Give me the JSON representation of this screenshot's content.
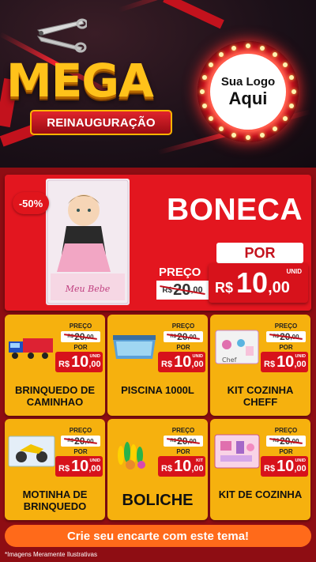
{
  "header": {
    "title_main": "MEGA",
    "title_sub": "REINAUGURAÇÃO",
    "logo_line1": "Sua Logo",
    "logo_line2": "Aqui"
  },
  "hero": {
    "discount": "-50%",
    "name": "BONECA",
    "por_label": "POR",
    "preco_label": "PREÇO",
    "old_currency": "R$",
    "old_int": "20",
    "old_dec": ",00",
    "unit_label": "UNID",
    "currency": "R$",
    "price_int": "10",
    "price_dec": ",00"
  },
  "products": [
    {
      "name": "BRINQUEDO DE CAMINHAO",
      "preco_label": "PREÇO",
      "old_currency": "R$",
      "old_int": "20",
      "old_dec": ",00",
      "por_label": "POR",
      "unit": "UNID",
      "currency": "R$",
      "price_int": "10",
      "price_dec": ",00",
      "icon": "toy-truck-icon"
    },
    {
      "name": "PISCINA 1000L",
      "preco_label": "PREÇO",
      "old_currency": "R$",
      "old_int": "20",
      "old_dec": ",00",
      "por_label": "POR",
      "unit": "UNID",
      "currency": "R$",
      "price_int": "10",
      "price_dec": ",00",
      "icon": "pool-icon"
    },
    {
      "name": "KIT COZINHA CHEFF",
      "preco_label": "PREÇO",
      "old_currency": "R$",
      "old_int": "20",
      "old_dec": ",00",
      "por_label": "POR",
      "unit": "UNID",
      "currency": "R$",
      "price_int": "10",
      "price_dec": ",00",
      "icon": "kitchen-kit-icon"
    },
    {
      "name": "MOTINHA DE BRINQUEDO",
      "preco_label": "PREÇO",
      "old_currency": "R$",
      "old_int": "20",
      "old_dec": ",00",
      "por_label": "POR",
      "unit": "UNID",
      "currency": "R$",
      "price_int": "10",
      "price_dec": ",00",
      "icon": "toy-motorbike-icon"
    },
    {
      "name": "BOLICHE",
      "preco_label": "PREÇO",
      "old_currency": "R$",
      "old_int": "20",
      "old_dec": ",00",
      "por_label": "POR",
      "unit": "KIT",
      "currency": "R$",
      "price_int": "10",
      "price_dec": ",00",
      "icon": "bowling-icon"
    },
    {
      "name": "KIT DE COZINHA",
      "preco_label": "PREÇO",
      "old_currency": "R$",
      "old_int": "20",
      "old_dec": ",00",
      "por_label": "POR",
      "unit": "UNID",
      "currency": "R$",
      "price_int": "10",
      "price_dec": ",00",
      "icon": "kitchen-set-icon"
    }
  ],
  "cta": "Crie seu encarte com este tema!",
  "footnote": "*Imagens Meramente Ilustrativas",
  "colors": {
    "red": "#e3161f",
    "dark_red": "#8e0d13",
    "yellow": "#f6b10e",
    "orange": "#ff6a1a",
    "gold": "#ffc21a"
  }
}
